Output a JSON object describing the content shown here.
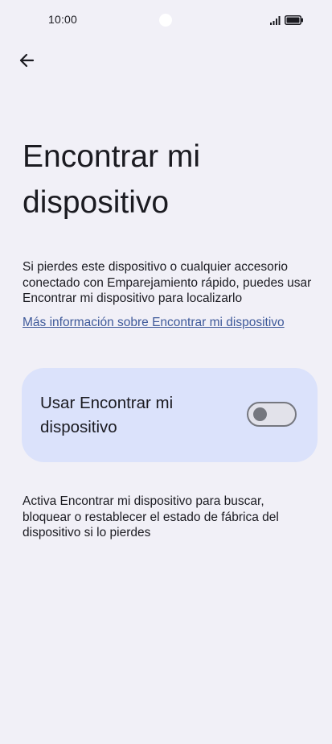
{
  "status_bar": {
    "time": "10:00",
    "icons": [
      "signal-icon",
      "battery-icon"
    ]
  },
  "header": {
    "back_icon": "arrow-left-icon"
  },
  "page": {
    "title": "Encontrar mi dispositivo",
    "description": "Si pierdes este dispositivo o cualquier accesorio conectado con Emparejamiento rápido, puedes usar Encontrar mi dispositivo para localizarlo",
    "more_info_link": "Más información sobre Encontrar mi dispositivo"
  },
  "toggle": {
    "label": "Usar Encontrar mi dispositivo",
    "state": "off"
  },
  "footer": {
    "text": "Activa Encontrar mi dispositivo para buscar, bloquear o restablecer el estado de fábrica del dispositivo si lo pierdes"
  },
  "colors": {
    "background": "#f1f0f7",
    "card": "#dbe2fb",
    "link": "#3f5a9a",
    "switch_outline": "#75777f"
  }
}
